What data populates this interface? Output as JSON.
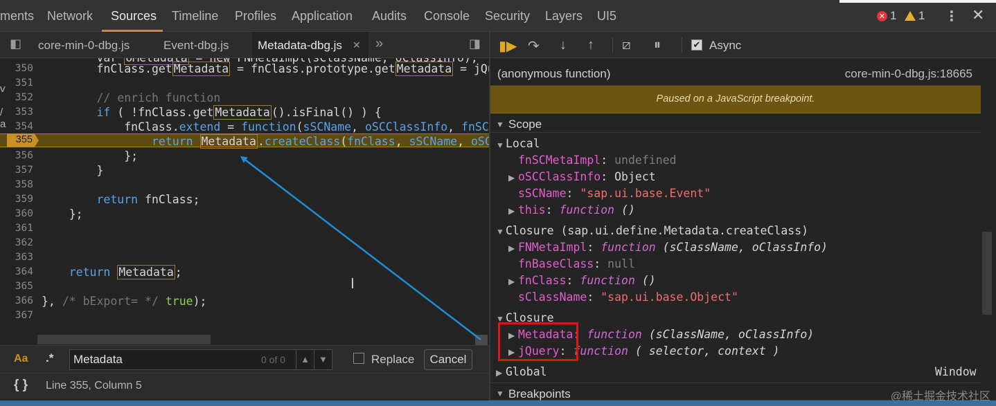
{
  "main_tabs": [
    {
      "label": "ments"
    },
    {
      "label": "Network"
    },
    {
      "label": "Sources"
    },
    {
      "label": "Timeline"
    },
    {
      "label": "Profiles"
    },
    {
      "label": "Application"
    },
    {
      "label": "Audits"
    },
    {
      "label": "Console"
    },
    {
      "label": "Security"
    },
    {
      "label": "Layers"
    },
    {
      "label": "UI5"
    }
  ],
  "status_counts": {
    "errors": "1",
    "warnings": "1"
  },
  "file_tabs": [
    {
      "label": "core-min-0-dbg.js"
    },
    {
      "label": "Event-dbg.js"
    },
    {
      "label": "Metadata-dbg.js"
    }
  ],
  "editor": {
    "lines": [
      {
        "no": "350"
      },
      {
        "no": "351"
      },
      {
        "no": "352"
      },
      {
        "no": "353"
      },
      {
        "no": "354"
      },
      {
        "no": "355"
      },
      {
        "no": "356"
      },
      {
        "no": "357"
      },
      {
        "no": "358"
      },
      {
        "no": "359"
      },
      {
        "no": "360"
      },
      {
        "no": "361"
      },
      {
        "no": "362"
      },
      {
        "no": "363"
      },
      {
        "no": "364"
      },
      {
        "no": "365"
      },
      {
        "no": "366"
      },
      {
        "no": "367"
      }
    ],
    "current_line": "355"
  },
  "search": {
    "value": "Metadata",
    "count": "0 of 0",
    "replace_label": "Replace",
    "cancel_label": "Cancel",
    "case_label": "Aa",
    "regex_label": ".*"
  },
  "status": {
    "position": "Line 355, Column 5",
    "format_label": "{ }"
  },
  "debugger": {
    "async_label": "Async",
    "call_frame": {
      "name": "(anonymous function)",
      "location": "core-min-0-dbg.js:18665"
    },
    "paused_message": "Paused on a JavaScript breakpoint.",
    "scope_title": "Scope",
    "local_title": "Local",
    "local": [
      {
        "name": "fnSCMetaImpl",
        "value": "undefined"
      },
      {
        "name": "oSCClassInfo",
        "value": "Object"
      },
      {
        "name": "sSCName",
        "value": "\"sap.ui.base.Event\""
      },
      {
        "name": "this",
        "value": "function",
        "args": "()"
      }
    ],
    "closure1_title": "Closure (sap.ui.define.Metadata.createClass)",
    "closure1": [
      {
        "name": "FNMetaImpl",
        "value": "function",
        "args": "(sClassName, oClassInfo)"
      },
      {
        "name": "fnBaseClass",
        "value": "null"
      },
      {
        "name": "fnClass",
        "value": "function",
        "args": "()"
      },
      {
        "name": "sClassName",
        "value": "\"sap.ui.base.Object\""
      }
    ],
    "closure2_title": "Closure",
    "closure2": [
      {
        "name": "Metadata",
        "value": "function",
        "args": "(sClassName, oClassInfo)"
      },
      {
        "name": "jQuery",
        "value": "function",
        "args": "( selector, context )"
      }
    ],
    "global_title": "Global",
    "global_value": "Window",
    "breakpoints_title": "Breakpoints"
  },
  "watermark": "@稀土掘金技术社区",
  "colors": {
    "accent": "#c69026",
    "paused_bg": "#6b5510",
    "highlight_box": "#e01414",
    "arrow": "#1e8fd6"
  }
}
